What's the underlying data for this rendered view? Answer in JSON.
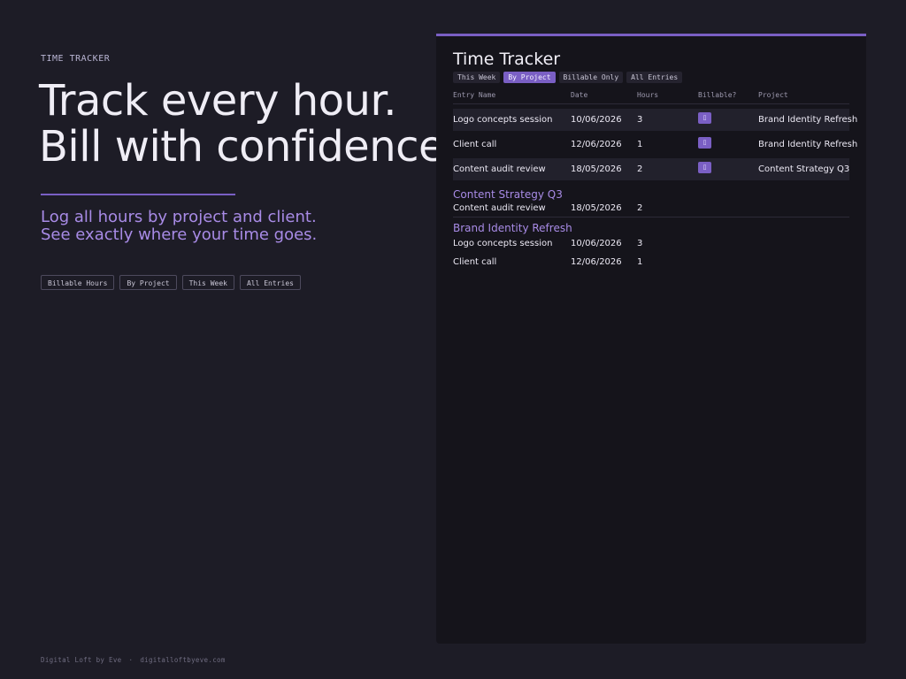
{
  "hero": {
    "eyebrow": "TIME TRACKER",
    "headline_line1": "Track every hour.",
    "headline_line2": "Bill with confidence.",
    "subhead_line1": "Log all hours by project and client.",
    "subhead_line2": "See exactly where your time goes.",
    "chips": [
      "Billable Hours",
      "By Project",
      "This Week",
      "All Entries"
    ]
  },
  "footer": {
    "brand": "Digital Loft by Eve",
    "separator": "·",
    "url": "digitalloftbyeve.com"
  },
  "panel": {
    "title": "Time Tracker",
    "tabs": [
      "This Week",
      "By Project",
      "Billable Only",
      "All Entries"
    ],
    "active_tab": "By Project",
    "columns": [
      "Entry Name",
      "Date",
      "Hours",
      "Billable?",
      "Project"
    ],
    "rows": [
      {
        "name": "Logo concepts session",
        "date": "10/06/2026",
        "hours": "3",
        "billable_icon": "checkbox-checked",
        "billable_glyph": "▯",
        "project": "Brand Identity Refresh"
      },
      {
        "name": "Client call",
        "date": "12/06/2026",
        "hours": "1",
        "billable_icon": "checkbox-checked",
        "billable_glyph": "▯",
        "project": "Brand Identity Refresh"
      },
      {
        "name": "Content audit review",
        "date": "18/05/2026",
        "hours": "2",
        "billable_icon": "checkbox-checked",
        "billable_glyph": "▯",
        "project": "Content Strategy Q3"
      }
    ],
    "groups": [
      {
        "title": "Content Strategy Q3",
        "entries": [
          {
            "name": "Content audit review",
            "date": "18/05/2026",
            "hours": "2"
          }
        ]
      },
      {
        "title": "Brand Identity Refresh",
        "entries": [
          {
            "name": "Logo concepts session",
            "date": "10/06/2026",
            "hours": "3"
          },
          {
            "name": "Client call",
            "date": "12/06/2026",
            "hours": "1"
          }
        ]
      }
    ]
  },
  "colors": {
    "background": "#1d1c26",
    "panel": "#15141b",
    "accent": "#7a5fc4",
    "accent_text": "#a88be6"
  }
}
